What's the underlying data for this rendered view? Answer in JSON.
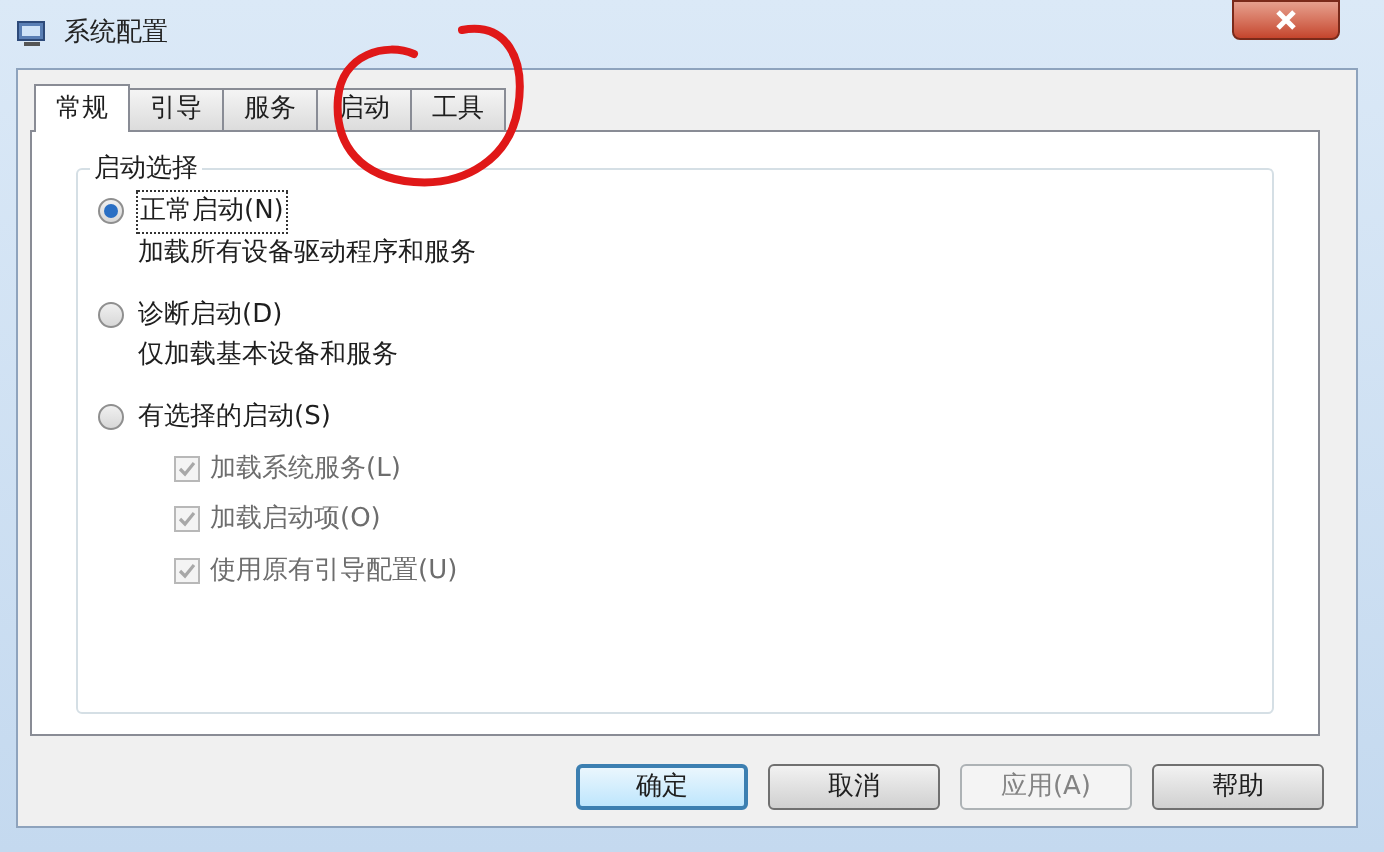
{
  "window": {
    "title": "系统配置"
  },
  "tabs": [
    {
      "label": "常规",
      "selected": true
    },
    {
      "label": "引导",
      "selected": false
    },
    {
      "label": "服务",
      "selected": false
    },
    {
      "label": "启动",
      "selected": false
    },
    {
      "label": "工具",
      "selected": false
    }
  ],
  "group": {
    "title": "启动选择",
    "options": [
      {
        "label": "正常启动(N)",
        "description": "加载所有设备驱动程序和服务",
        "selected": true
      },
      {
        "label": "诊断启动(D)",
        "description": "仅加载基本设备和服务",
        "selected": false
      },
      {
        "label": "有选择的启动(S)",
        "selected": false,
        "checkboxes": [
          {
            "label": "加载系统服务(L)",
            "checked": true,
            "disabled": true
          },
          {
            "label": "加载启动项(O)",
            "checked": true,
            "disabled": true
          },
          {
            "label": "使用原有引导配置(U)",
            "checked": true,
            "disabled": true
          }
        ]
      }
    ]
  },
  "buttons": [
    {
      "label": "确定",
      "default": true,
      "disabled": false
    },
    {
      "label": "取消",
      "default": false,
      "disabled": false
    },
    {
      "label": "应用(A)",
      "default": false,
      "disabled": true
    },
    {
      "label": "帮助",
      "default": false,
      "disabled": false
    }
  ]
}
